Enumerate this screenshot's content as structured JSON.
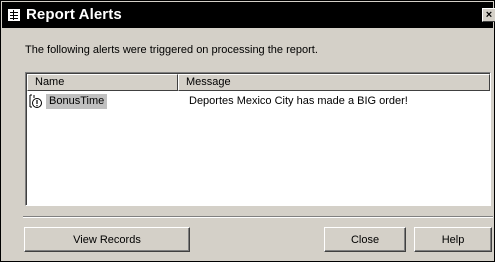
{
  "window": {
    "title": "Report Alerts",
    "close_glyph": "×"
  },
  "intro_text": "The following alerts were triggered on processing the report.",
  "list": {
    "columns": [
      "Name",
      "Message"
    ],
    "rows": [
      {
        "icon": "alert-warning-icon",
        "name": "BonusTime",
        "message": "Deportes Mexico City has made a BIG order!"
      }
    ]
  },
  "buttons": {
    "view_records": "View Records",
    "close": "Close",
    "help": "Help"
  },
  "colors": {
    "titlebar": "#000000",
    "dialog_face": "#d4d0c8",
    "selection": "#c0c0c0"
  }
}
